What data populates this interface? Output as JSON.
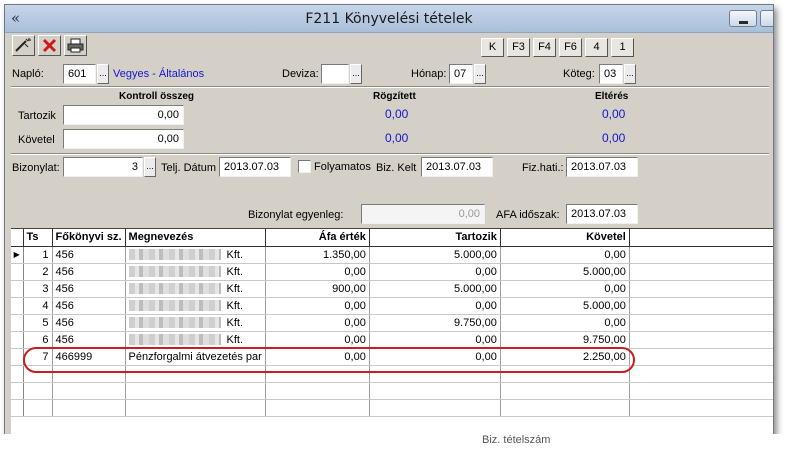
{
  "window": {
    "title": "F211 Könyvelési tételek",
    "app_icon": "«",
    "min_icon": "minimize-icon"
  },
  "toolbar": {
    "icons": [
      "wand-icon",
      "delete-icon",
      "print-icon"
    ],
    "keys": [
      "K",
      "F3",
      "F4",
      "F6",
      "4",
      "1"
    ]
  },
  "header": {
    "naplo_label": "Napló:",
    "naplo_value": "601",
    "naplo_name": "Vegyes - Általános",
    "deviza_label": "Deviza:",
    "deviza_value": "",
    "honap_label": "Hónap:",
    "honap_value": "07",
    "koteg_label": "Köteg:",
    "koteg_value": "03"
  },
  "control": {
    "kontroll_header": "Kontroll összeg",
    "rogzitett_header": "Rögzített",
    "elteres_header": "Eltérés",
    "tartozik_label": "Tartozik",
    "tartozik_value": "0,00",
    "tartozik_rogzitett": "0,00",
    "tartozik_elteres": "0,00",
    "kovetel_label": "Követel",
    "kovetel_value": "0,00",
    "kovetel_rogzitett": "0,00",
    "kovetel_elteres": "0,00"
  },
  "document": {
    "bizonylat_label": "Bizonylat:",
    "bizonylat_value": "3",
    "teli_datum_label": "Telj. Dátum",
    "teli_datum_value": "2013.07.03",
    "folyamatos_label": "Folyamatos",
    "biz_kelt_label": "Biz. Kelt",
    "biz_kelt_value": "2013.07.03",
    "fiz_hati_label": "Fiz.hati.:",
    "fiz_hati_value": "2013.07.03",
    "egyenleg_label": "Bizonylat egyenleg:",
    "egyenleg_value": "0,00",
    "afa_idoszak_label": "AFA időszak:",
    "afa_idoszak_value": "2013.07.03"
  },
  "grid": {
    "headers": [
      "Ts",
      "Főkönyvi sz.",
      "Megnevezés",
      "Áfa érték",
      "Tartozik",
      "Követel"
    ],
    "rows": [
      {
        "ts": "1",
        "fokonyv": "456",
        "name_suffix": "Kft.",
        "afa": "1.350,00",
        "tartozik": "5.000,00",
        "kovetel": "0,00",
        "blurred": true
      },
      {
        "ts": "2",
        "fokonyv": "456",
        "name_suffix": "Kft.",
        "afa": "0,00",
        "tartozik": "0,00",
        "kovetel": "5.000,00",
        "blurred": true
      },
      {
        "ts": "3",
        "fokonyv": "456",
        "name_suffix": "Kft.",
        "afa": "900,00",
        "tartozik": "5.000,00",
        "kovetel": "0,00",
        "blurred": true
      },
      {
        "ts": "4",
        "fokonyv": "456",
        "name_suffix": "Kft.",
        "afa": "0,00",
        "tartozik": "0,00",
        "kovetel": "5.000,00",
        "blurred": true
      },
      {
        "ts": "5",
        "fokonyv": "456",
        "name_suffix": "Kft.",
        "afa": "0,00",
        "tartozik": "9.750,00",
        "kovetel": "0,00",
        "blurred": true
      },
      {
        "ts": "6",
        "fokonyv": "456",
        "name_suffix": "Kft.",
        "afa": "0,00",
        "tartozik": "0,00",
        "kovetel": "9.750,00",
        "blurred": true
      },
      {
        "ts": "7",
        "fokonyv": "466999",
        "name_suffix": "Pénzforgalmi átvezetés par",
        "afa": "0,00",
        "tartozik": "0,00",
        "kovetel": "2.250,00",
        "blurred": false
      }
    ],
    "footer_fragment": "Biz. tételszám"
  }
}
